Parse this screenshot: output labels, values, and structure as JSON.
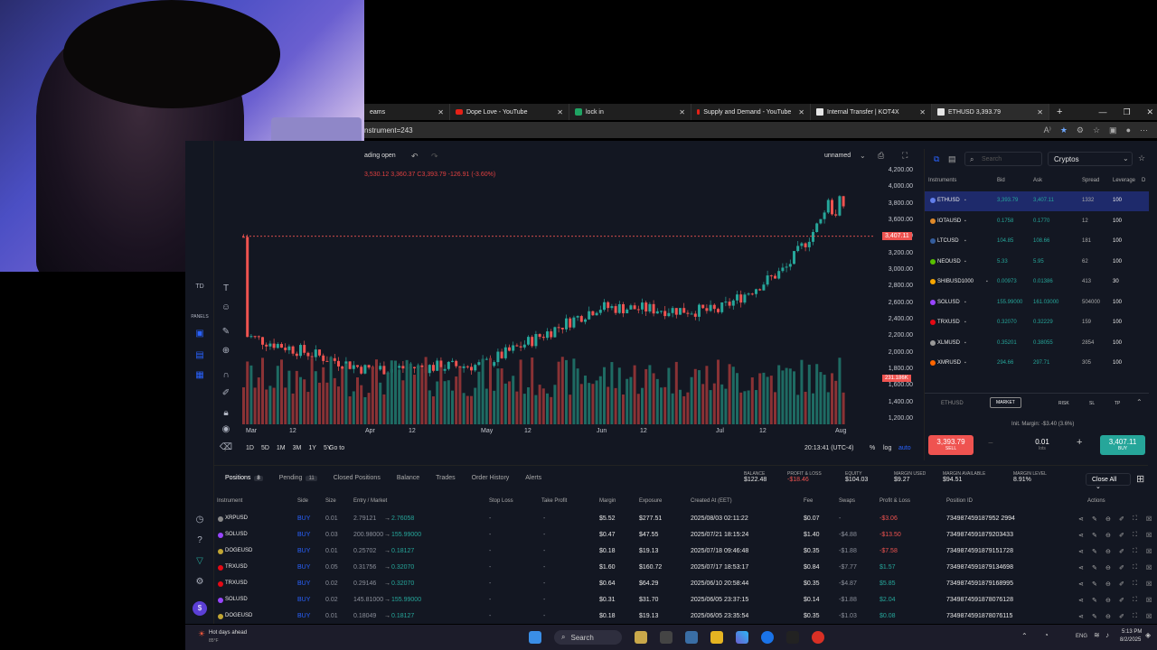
{
  "browser": {
    "tabs": [
      {
        "label": "eams",
        "icon": "none"
      },
      {
        "label": "Dope Love - YouTube",
        "icon": "youtube-icon"
      },
      {
        "label": "lock in",
        "icon": "green-icon"
      },
      {
        "label": "Supply and Demand - YouTube",
        "icon": "youtube-icon"
      },
      {
        "label": "Internal Transfer | KOT4X",
        "icon": "page-icon"
      },
      {
        "label": "ETHUSD 3,393.79",
        "icon": "page-icon",
        "active": true
      }
    ],
    "close_glyph": "✕",
    "new_tab": "+",
    "url": "nstrument=243"
  },
  "chart": {
    "header_left": "ading open",
    "layout_name": "unnamed",
    "ohlc": "3,530.12  3,360.37  C3,393.79  -126.91 (-3.60%)",
    "price_labels": [
      "4,200.00",
      "4,000.00",
      "3,800.00",
      "3,600.00",
      "3,400.00",
      "3,200.00",
      "3,000.00",
      "2,800.00",
      "2,600.00",
      "2,400.00",
      "2,200.00",
      "2,000.00",
      "1,800.00",
      "1,600.00",
      "1,400.00",
      "1,200.00"
    ],
    "current_price_tag": "3,407.11",
    "volume_tag": "231.186K",
    "time_labels": [
      "Mar",
      "12",
      "Apr",
      "12",
      "May",
      "12",
      "Jun",
      "12",
      "Jul",
      "12",
      "Aug",
      "12"
    ],
    "ranges": [
      "1D",
      "5D",
      "1M",
      "3M",
      "1Y",
      "5Y"
    ],
    "goto": "Go to",
    "clock": "20:13:41 (UTC-4)",
    "pct": "%",
    "log": "log",
    "auto": "auto"
  },
  "chart_data": {
    "type": "candlestick",
    "x": [
      "Mar",
      "Apr",
      "May",
      "Jun",
      "Jul",
      "Aug"
    ],
    "close_approx": [
      2200,
      1800,
      1850,
      2550,
      2500,
      3400
    ],
    "ylim": [
      1200,
      4200
    ],
    "last_close": 3393.79,
    "ask": 3407.11
  },
  "panel": {
    "category": "Cryptos",
    "search_placeholder": "Search",
    "columns": [
      "Instruments",
      "Bid",
      "Ask",
      "Spread",
      "Leverage",
      "D"
    ],
    "rows": [
      {
        "sym": "ETHUSD",
        "bid": "3,393.79",
        "ask": "3,407.11",
        "spread": "1332",
        "lev": "100",
        "color": "#627eea"
      },
      {
        "sym": "IOTAUSD",
        "bid": "0.1758",
        "ask": "0.1770",
        "spread": "12",
        "lev": "100",
        "color": "#e08a2a"
      },
      {
        "sym": "LTCUSD",
        "bid": "104.85",
        "ask": "108.66",
        "spread": "181",
        "lev": "100",
        "color": "#345d9d"
      },
      {
        "sym": "NEOUSD",
        "bid": "5.33",
        "ask": "5.95",
        "spread": "62",
        "lev": "100",
        "color": "#58bf00"
      },
      {
        "sym": "SHIBUSD1000",
        "bid": "0.00973",
        "ask": "0.01386",
        "spread": "413",
        "lev": "30",
        "color": "#f7a600"
      },
      {
        "sym": "SOLUSD",
        "bid": "155.99000",
        "ask": "161.03000",
        "spread": "504000",
        "lev": "100",
        "color": "#9945ff"
      },
      {
        "sym": "TRXUSD",
        "bid": "0.32070",
        "ask": "0.32229",
        "spread": "159",
        "lev": "100",
        "color": "#e50914"
      },
      {
        "sym": "XLMUSD",
        "bid": "0.35201",
        "ask": "0.38055",
        "spread": "2854",
        "lev": "100",
        "color": "#999"
      },
      {
        "sym": "XMRUSD",
        "bid": "294.66",
        "ask": "297.71",
        "spread": "305",
        "lev": "100",
        "color": "#ff6600"
      }
    ],
    "order": {
      "symbol": "ETHUSD",
      "type": "MARKET",
      "risk": "RISK",
      "sl": "SL",
      "tp": "TP",
      "init_margin": "Init. Margin: -$3.40 (3.6%)",
      "sell": "3,393.79",
      "sell_label": "SELL",
      "buy": "3,407.11",
      "buy_label": "BUY",
      "lots": "0.01",
      "lots_label": "lots"
    }
  },
  "positions": {
    "tabs": [
      {
        "label": "Positions",
        "count": "8"
      },
      {
        "label": "Pending",
        "count": "11"
      },
      {
        "label": "Closed Positions"
      },
      {
        "label": "Balance"
      },
      {
        "label": "Trades"
      },
      {
        "label": "Order History"
      },
      {
        "label": "Alerts"
      }
    ],
    "summary": [
      {
        "label": "BALANCE",
        "value": "$122.48",
        "color": "#e8e8e8"
      },
      {
        "label": "PROFIT & LOSS",
        "value": "-$18.46",
        "color": "#ef5350"
      },
      {
        "label": "EQUITY",
        "value": "$104.03",
        "color": "#e8e8e8"
      },
      {
        "label": "MARGIN USED",
        "value": "$9.27",
        "color": "#e8e8e8"
      },
      {
        "label": "MARGIN AVAILABLE",
        "value": "$94.51",
        "color": "#e8e8e8"
      },
      {
        "label": "MARGIN LEVEL",
        "value": "8.91%",
        "color": "#e8e8e8"
      }
    ],
    "close_all": "Close All",
    "columns": [
      "Instrument",
      "Side",
      "Size",
      "Entry / Market",
      "Stop Loss",
      "Take Profit",
      "Margin",
      "Exposure",
      "Created At (EET)",
      "Fee",
      "Swaps",
      "Profit & Loss",
      "Position ID",
      "Actions"
    ],
    "rows": [
      {
        "sym": "XRPUSD",
        "side": "BUY",
        "size": "0.01",
        "entry": "2.79121",
        "market": "2.76058",
        "sl": "-",
        "tp": "-",
        "margin": "$5.52",
        "exp": "$277.51",
        "created": "2025/08/03 02:11:22",
        "fee": "$0.07",
        "swaps": "-",
        "pnl": "-$3.06",
        "id": "734987459187952 2994",
        "color": "#888"
      },
      {
        "sym": "SOLUSD",
        "side": "BUY",
        "size": "0.03",
        "entry": "200.98000",
        "market": "155.99000",
        "sl": "-",
        "tp": "-",
        "margin": "$0.47",
        "exp": "$47.55",
        "created": "2025/07/21 18:15:24",
        "fee": "$1.40",
        "swaps": "-$4.88",
        "pnl": "-$13.50",
        "id": "7349874591879203433",
        "color": "#9945ff"
      },
      {
        "sym": "DOGEUSD",
        "side": "BUY",
        "size": "0.01",
        "entry": "0.25702",
        "market": "0.18127",
        "sl": "-",
        "tp": "-",
        "margin": "$0.18",
        "exp": "$19.13",
        "created": "2025/07/18 09:46:48",
        "fee": "$0.35",
        "swaps": "-$1.88",
        "pnl": "-$7.58",
        "id": "7349874591879151728",
        "color": "#c2a633"
      },
      {
        "sym": "TRXUSD",
        "side": "BUY",
        "size": "0.05",
        "entry": "0.31756",
        "market": "0.32070",
        "sl": "-",
        "tp": "-",
        "margin": "$1.60",
        "exp": "$160.72",
        "created": "2025/07/17 18:53:17",
        "fee": "$0.84",
        "swaps": "-$7.77",
        "pnl": "$1.57",
        "id": "7349874591879134698",
        "color": "#e50914"
      },
      {
        "sym": "TRXUSD",
        "side": "BUY",
        "size": "0.02",
        "entry": "0.29146",
        "market": "0.32070",
        "sl": "-",
        "tp": "-",
        "margin": "$0.64",
        "exp": "$64.29",
        "created": "2025/06/10 20:58:44",
        "fee": "$0.35",
        "swaps": "-$4.87",
        "pnl": "$5.85",
        "id": "7349874591879168995",
        "color": "#e50914"
      },
      {
        "sym": "SOLUSD",
        "side": "BUY",
        "size": "0.02",
        "entry": "145.81000",
        "market": "155.99000",
        "sl": "-",
        "tp": "-",
        "margin": "$0.31",
        "exp": "$31.70",
        "created": "2025/06/05 23:37:15",
        "fee": "$0.14",
        "swaps": "-$1.88",
        "pnl": "$2.04",
        "id": "7349874591878076128",
        "color": "#9945ff"
      },
      {
        "sym": "DOGEUSD",
        "side": "BUY",
        "size": "0.01",
        "entry": "0.18049",
        "market": "0.18127",
        "sl": "-",
        "tp": "-",
        "margin": "$0.18",
        "exp": "$19.13",
        "created": "2025/06/05 23:35:54",
        "fee": "$0.35",
        "swaps": "-$1.03",
        "pnl": "$0.08",
        "id": "7349874591878076115",
        "color": "#c2a633"
      }
    ]
  },
  "taskbar": {
    "weather": "Hot days ahead",
    "temp": "85°F",
    "search": "Search",
    "lang": "ENG",
    "time": "5:13 PM",
    "date": "8/2/2025"
  }
}
